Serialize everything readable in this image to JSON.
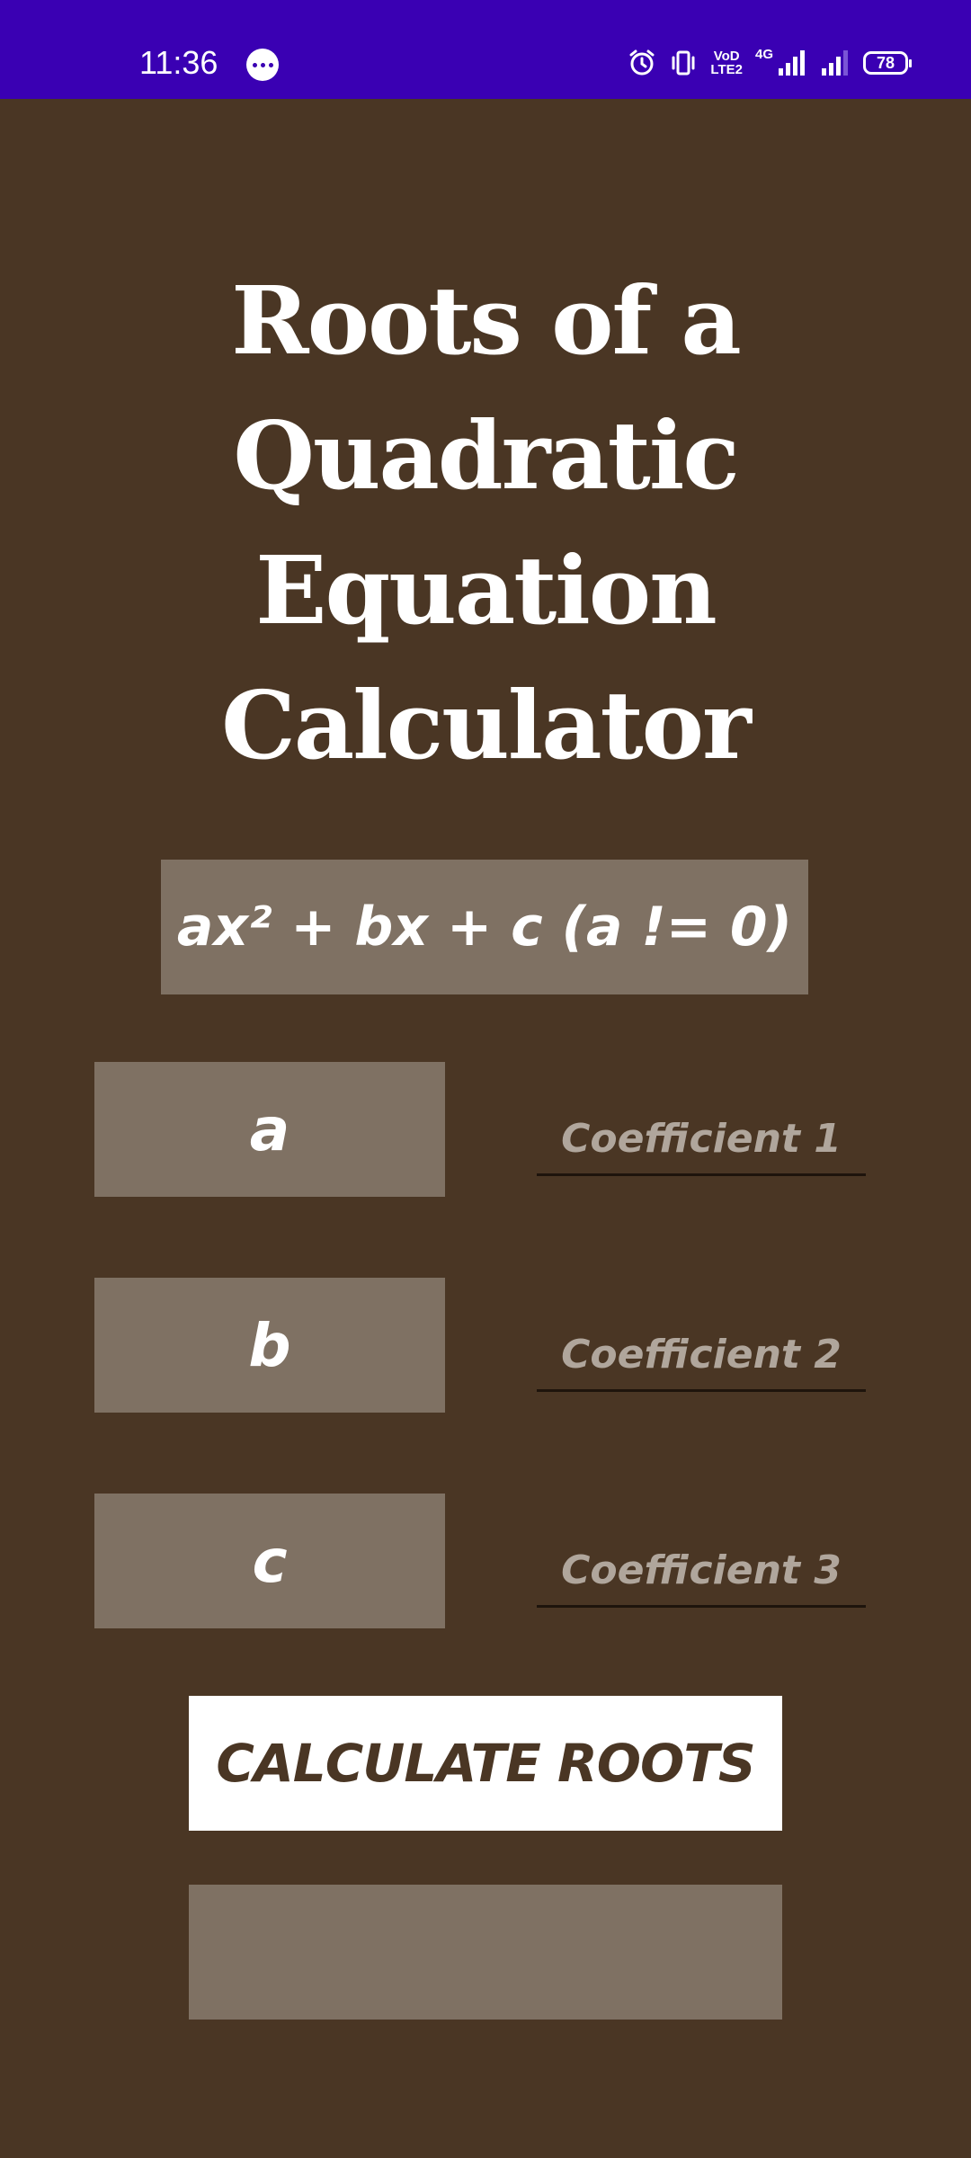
{
  "status_bar": {
    "time": "11:36",
    "network": "4G",
    "volte_top": "VoD",
    "volte_bottom": "LTE2",
    "battery": "78",
    "icons": [
      "chat-bubble-icon",
      "alarm-icon",
      "vibrate-icon",
      "volte-icon",
      "signal-icon",
      "signal-icon-2",
      "battery-icon"
    ]
  },
  "app": {
    "title": "Roots of a Quadratic Equation Calculator",
    "equation": "ax² + bx + c (a != 0)",
    "coefficients": [
      {
        "label": "a",
        "placeholder": "Coefficient 1",
        "value": ""
      },
      {
        "label": "b",
        "placeholder": "Coefficient 2",
        "value": ""
      },
      {
        "label": "c",
        "placeholder": "Coefficient 3",
        "value": ""
      }
    ],
    "calculate_label": "CALCULATE ROOTS",
    "result": ""
  },
  "colors": {
    "background": "#4a3624",
    "status_bar": "#3a00b3",
    "panel": "#7f7163",
    "button": "#ffffff",
    "button_text": "#4a3624"
  }
}
